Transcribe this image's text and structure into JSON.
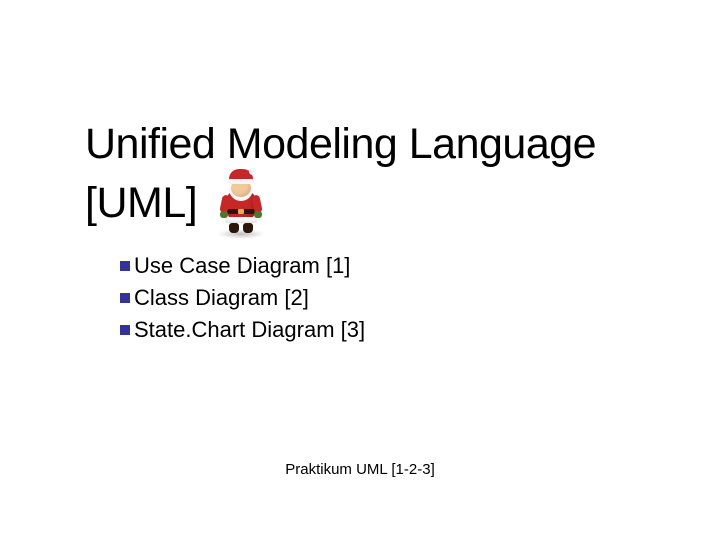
{
  "title": {
    "line1": "Unified Modeling Language",
    "line2": "[UML]"
  },
  "bullets": [
    {
      "label": "Use Case Diagram [1]"
    },
    {
      "label": "Class Diagram [2]"
    },
    {
      "label": "State.Chart Diagram [3]"
    }
  ],
  "footer": "Praktikum UML [1-2-3]",
  "decor": {
    "santa_icon": "santa-figure-icon"
  }
}
